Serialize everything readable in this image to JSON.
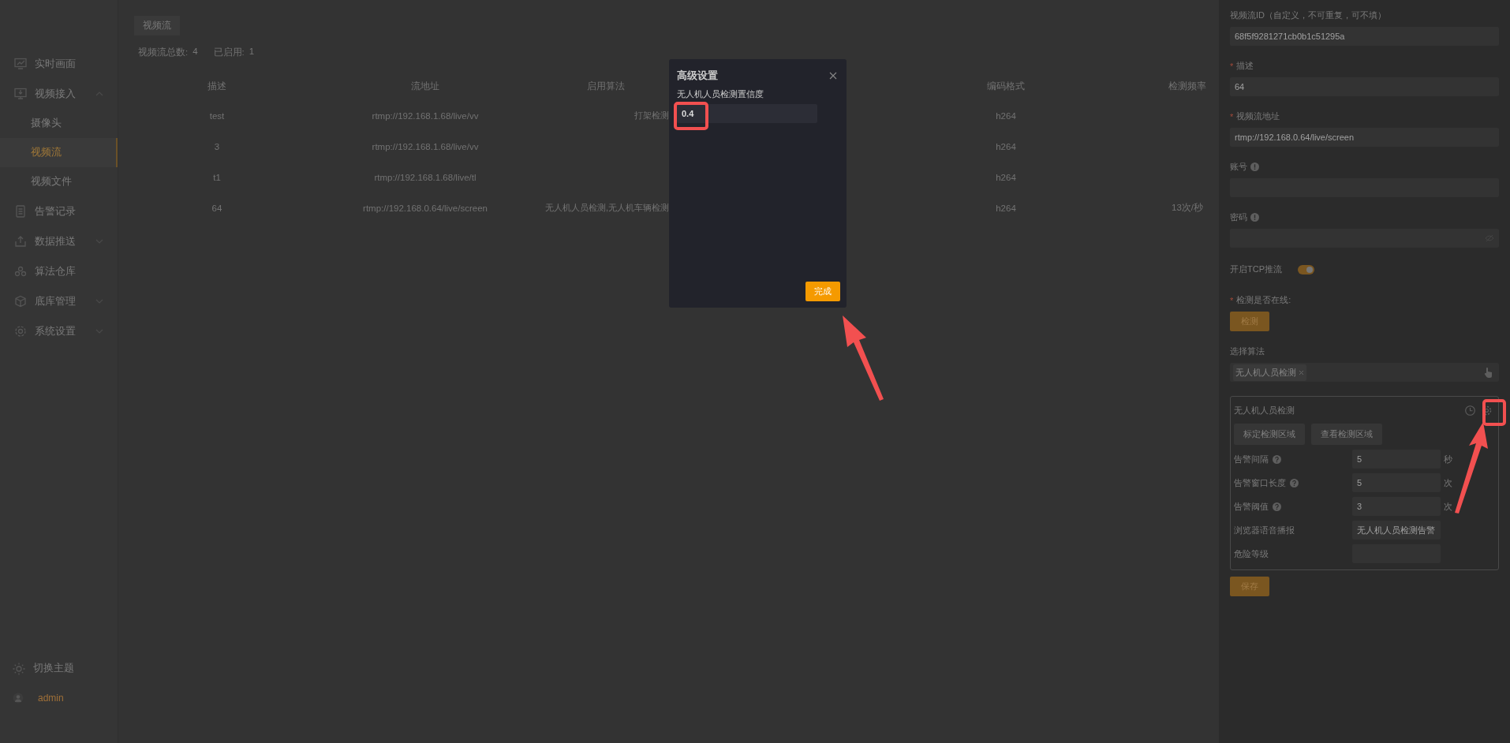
{
  "sidebar": {
    "items": [
      {
        "label": "实时画面",
        "selected": false
      },
      {
        "label": "视频接入",
        "selected": false,
        "expanded": true,
        "children": [
          {
            "label": "摄像头",
            "selected": false
          },
          {
            "label": "视频流",
            "selected": true
          },
          {
            "label": "视频文件",
            "selected": false
          }
        ]
      },
      {
        "label": "告警记录",
        "selected": false
      },
      {
        "label": "数据推送",
        "selected": false,
        "expanded": false
      },
      {
        "label": "算法仓库",
        "selected": false
      },
      {
        "label": "底库管理",
        "selected": false,
        "expanded": false
      },
      {
        "label": "系统设置",
        "selected": false,
        "expanded": false
      }
    ],
    "theme_toggle": "切换主题",
    "user": "admin"
  },
  "main": {
    "tab": "视频流",
    "stats": [
      {
        "label": "视频流总数:",
        "value": "4"
      },
      {
        "label": "已启用:",
        "value": "1"
      }
    ],
    "table": {
      "columns": [
        "描述",
        "流地址",
        "启用算法",
        "编码格式",
        "检测频率"
      ],
      "rows": [
        {
          "description": "test",
          "url": "rtmp://192.168.1.68/live/vv",
          "algorithms": "打架检测",
          "codec": "h264"
        },
        {
          "description": "3",
          "url": "rtmp://192.168.1.68/live/vv",
          "codec": "h264"
        },
        {
          "description": "t1",
          "url": "rtmp://192.168.1.68/live/tl",
          "codec": "h264"
        },
        {
          "description": "64",
          "url": "rtmp://192.168.0.64/live/screen",
          "algorithms": "无人机人员检测,无人机车辆检测",
          "codec": "h264",
          "frequency": "13次/秒"
        }
      ]
    }
  },
  "drawer": {
    "fields": [
      {
        "kind": "input",
        "label": "视频流ID（自定义，不可重复，可不填）",
        "value": "68f5f9281271cb0b1c51295a"
      },
      {
        "kind": "input",
        "label": "描述",
        "required_mark": "*",
        "value": "64"
      },
      {
        "kind": "input",
        "label": "视频流地址",
        "required_mark": "*",
        "value": "rtmp://192.168.0.64/live/screen"
      },
      {
        "kind": "input",
        "label": "账号",
        "info": true
      },
      {
        "kind": "password",
        "label": "密码",
        "info": true
      },
      {
        "kind": "switch",
        "label": "开启TCP推流",
        "on": true
      },
      {
        "kind": "button",
        "label": "检测是否在线:",
        "required_mark": "*",
        "button": "检测"
      },
      {
        "kind": "select",
        "label": "选择算法",
        "tags": [
          "无人机人员检测"
        ]
      }
    ],
    "algorithm_card": {
      "title": "无人机人员检测",
      "buttons": [
        "标定检测区域",
        "查看检测区域"
      ],
      "rows": [
        {
          "label": "告警间隔",
          "help": true,
          "value": "5",
          "unit": "秒"
        },
        {
          "label": "告警窗口长度",
          "help": true,
          "value": "5",
          "unit": "次"
        },
        {
          "label": "告警阈值",
          "help": true,
          "value": "3",
          "unit": "次"
        },
        {
          "label": "浏览器语音播报",
          "value": "无人机人员检测告警"
        },
        {
          "label": "危险等级"
        }
      ]
    },
    "save_button": "保存"
  },
  "modal": {
    "title": "高级设置",
    "field_label": "无人机人员检测置信度",
    "value": "0.4",
    "confirm": "完成"
  }
}
